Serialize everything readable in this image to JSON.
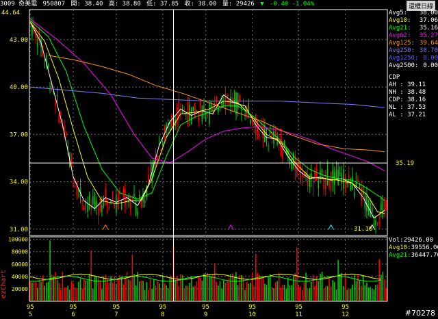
{
  "header": {
    "code_name": "3009 奇美電",
    "date": "950807",
    "open": "開: 38.40",
    "high": "高: 38.80",
    "low": "低: 37.85",
    "close": "收: 38.00",
    "volume": "量: 29426",
    "change": "-0.40 -1.04%",
    "change_color": "#00ff00",
    "restore_button": "還權日線"
  },
  "ma_legend": [
    {
      "label": "Avg5:",
      "value": "38.00",
      "color": "#ffffff"
    },
    {
      "label": "Avg10:",
      "value": "37.06",
      "color": "#ffff00"
    },
    {
      "label": "Avg21:",
      "value": "35.16",
      "color": "#00ff00"
    },
    {
      "label": "Avg62:",
      "value": "35.27",
      "color": "#ff00ff"
    },
    {
      "label": "Avg125:",
      "value": "39.64",
      "color": "#ff9900"
    },
    {
      "label": "Avg250:",
      "value": "38.70",
      "color": "#8080ff"
    },
    {
      "label": "Avg1250:",
      "value": "0.00",
      "color": "#4040ff"
    },
    {
      "label": "Avg2500:",
      "value": "0.00",
      "color": "#ffffff"
    }
  ],
  "cdp": {
    "title": "CDP",
    "rows": [
      {
        "label": "AH :",
        "value": "39.11"
      },
      {
        "label": "NH :",
        "value": "38.48"
      },
      {
        "label": "CDP:",
        "value": "38.16"
      },
      {
        "label": "NL :",
        "value": "37.53"
      },
      {
        "label": "AL :",
        "value": "37.21"
      }
    ]
  },
  "volume_legend": [
    {
      "label": "Vol:",
      "value": "29426.00",
      "color": "#ffffff"
    },
    {
      "label": "Avg10:",
      "value": "39556.00",
      "color": "#ffff00"
    },
    {
      "label": "Avg21:",
      "value": "36447.76",
      "color": "#00ff00"
    }
  ],
  "crosshair_price": "35.19",
  "range_top": "44.64",
  "range_bottom": "31.10",
  "brand": "ezChart",
  "watermark": "#70278",
  "colors": {
    "up": "#ff0000",
    "down": "#00cc00",
    "grid": "#707070",
    "axis": "#ffffff",
    "tick": "#ffff00"
  },
  "chart_data": [
    {
      "type": "candlestick",
      "title": "3009 奇美電",
      "x_ticks": [
        {
          "year": "95",
          "month": "5"
        },
        {
          "year": "95",
          "month": "6"
        },
        {
          "year": "95",
          "month": "7"
        },
        {
          "year": "95",
          "month": "8"
        },
        {
          "year": "95",
          "month": "9"
        },
        {
          "year": "95",
          "month": "10"
        },
        {
          "year": "95",
          "month": "11"
        },
        {
          "year": "95",
          "month": "12"
        }
      ],
      "y_ticks": [
        "43.00",
        "40.00",
        "37.00",
        "34.00",
        "31.00"
      ],
      "ylim": [
        30.6,
        44.9
      ],
      "moving_average_shapes": [
        {
          "name": "Avg5",
          "color": "#ffffff",
          "points": [
            [
              0,
              44.1
            ],
            [
              6,
              42.8
            ],
            [
              12,
              40.2
            ],
            [
              18,
              37.6
            ],
            [
              24,
              34.3
            ],
            [
              30,
              32.8
            ],
            [
              36,
              32.3
            ],
            [
              42,
              33.0
            ],
            [
              48,
              32.7
            ],
            [
              54,
              33.0
            ],
            [
              60,
              32.5
            ],
            [
              66,
              33.8
            ],
            [
              72,
              36.3
            ],
            [
              78,
              37.8
            ],
            [
              84,
              38.6
            ],
            [
              90,
              38.2
            ],
            [
              96,
              38.5
            ],
            [
              102,
              38.3
            ],
            [
              108,
              39.5
            ],
            [
              114,
              39.0
            ],
            [
              120,
              38.8
            ],
            [
              126,
              37.6
            ],
            [
              132,
              36.8
            ],
            [
              138,
              36.7
            ],
            [
              144,
              35.6
            ],
            [
              150,
              34.7
            ],
            [
              156,
              34.2
            ],
            [
              162,
              34.3
            ],
            [
              168,
              34.1
            ],
            [
              174,
              34.2
            ],
            [
              180,
              33.9
            ],
            [
              186,
              33.0
            ],
            [
              192,
              31.7
            ],
            [
              198,
              32.2
            ]
          ]
        },
        {
          "name": "Avg10",
          "color": "#ffff00",
          "points": [
            [
              0,
              44.1
            ],
            [
              8,
              42.9
            ],
            [
              16,
              40.5
            ],
            [
              24,
              37.3
            ],
            [
              32,
              34.3
            ],
            [
              40,
              32.8
            ],
            [
              48,
              32.6
            ],
            [
              56,
              32.8
            ],
            [
              62,
              32.8
            ],
            [
              68,
              34.2
            ],
            [
              76,
              36.8
            ],
            [
              84,
              38.3
            ],
            [
              92,
              38.4
            ],
            [
              100,
              38.6
            ],
            [
              108,
              39.1
            ],
            [
              116,
              39.0
            ],
            [
              124,
              38.1
            ],
            [
              132,
              37.0
            ],
            [
              140,
              36.5
            ],
            [
              148,
              35.2
            ],
            [
              156,
              34.3
            ],
            [
              164,
              34.2
            ],
            [
              172,
              34.1
            ],
            [
              180,
              33.9
            ],
            [
              188,
              33.2
            ],
            [
              194,
              32.1
            ],
            [
              198,
              32.0
            ]
          ]
        },
        {
          "name": "Avg21",
          "color": "#00ff00",
          "points": [
            [
              0,
              44.2
            ],
            [
              10,
              43.2
            ],
            [
              20,
              41.0
            ],
            [
              30,
              37.5
            ],
            [
              40,
              34.8
            ],
            [
              50,
              33.3
            ],
            [
              60,
              32.9
            ],
            [
              68,
              33.3
            ],
            [
              76,
              35.6
            ],
            [
              84,
              37.6
            ],
            [
              92,
              38.1
            ],
            [
              100,
              38.4
            ],
            [
              108,
              38.8
            ],
            [
              116,
              38.8
            ],
            [
              124,
              38.2
            ],
            [
              132,
              37.4
            ],
            [
              140,
              36.6
            ],
            [
              148,
              35.5
            ],
            [
              156,
              34.8
            ],
            [
              164,
              34.4
            ],
            [
              172,
              34.2
            ],
            [
              180,
              34.1
            ],
            [
              188,
              33.6
            ],
            [
              196,
              33.0
            ],
            [
              198,
              32.8
            ]
          ]
        },
        {
          "name": "Avg62",
          "color": "#ff00ff",
          "points": [
            [
              0,
              44.3
            ],
            [
              15,
              43.0
            ],
            [
              30,
              41.5
            ],
            [
              45,
              39.5
            ],
            [
              58,
              37.0
            ],
            [
              68,
              35.5
            ],
            [
              78,
              35.2
            ],
            [
              88,
              35.9
            ],
            [
              98,
              36.7
            ],
            [
              108,
              37.2
            ],
            [
              118,
              37.4
            ],
            [
              128,
              37.5
            ],
            [
              138,
              37.3
            ],
            [
              148,
              37.0
            ],
            [
              158,
              36.6
            ],
            [
              168,
              36.1
            ],
            [
              178,
              35.7
            ],
            [
              188,
              35.3
            ],
            [
              198,
              34.7
            ]
          ]
        },
        {
          "name": "Avg125",
          "color": "#ff9900",
          "points": [
            [
              10,
              42.0
            ],
            [
              25,
              41.7
            ],
            [
              40,
              41.3
            ],
            [
              55,
              40.8
            ],
            [
              70,
              40.1
            ],
            [
              85,
              39.6
            ],
            [
              100,
              39.0
            ],
            [
              115,
              38.4
            ],
            [
              130,
              37.8
            ],
            [
              145,
              37.0
            ],
            [
              160,
              36.4
            ],
            [
              175,
              36.1
            ],
            [
              190,
              36.0
            ],
            [
              198,
              35.9
            ]
          ]
        },
        {
          "name": "Avg250",
          "color": "#8080ff",
          "points": [
            [
              0,
              40.0
            ],
            [
              20,
              39.8
            ],
            [
              40,
              39.6
            ],
            [
              60,
              39.3
            ],
            [
              80,
              39.2
            ],
            [
              100,
              39.1
            ],
            [
              120,
              39.1
            ],
            [
              140,
              39.1
            ],
            [
              160,
              39.0
            ],
            [
              180,
              38.9
            ],
            [
              198,
              38.7
            ]
          ]
        }
      ],
      "triangle_markers": [
        {
          "x": 42,
          "y": 31.1,
          "color": "#ff8800"
        },
        {
          "x": 112,
          "y": 31.1,
          "color": "#ff00ff"
        },
        {
          "x": 168,
          "y": 31.1,
          "color": "#00ffff"
        },
        {
          "x": 191,
          "y": 31.1,
          "color": "#ffffff"
        }
      ],
      "sessions": 200
    },
    {
      "type": "bar",
      "title": "Volume",
      "y_ticks": [
        "100000",
        "80000",
        "60000",
        "40000",
        "20000"
      ],
      "ylim": [
        0,
        104000
      ],
      "avg_lines": [
        {
          "name": "Avg10",
          "color": "#ffff00",
          "value": 39556.0
        },
        {
          "name": "Avg21",
          "color": "#00ff00",
          "value": 36447.76
        }
      ]
    }
  ]
}
